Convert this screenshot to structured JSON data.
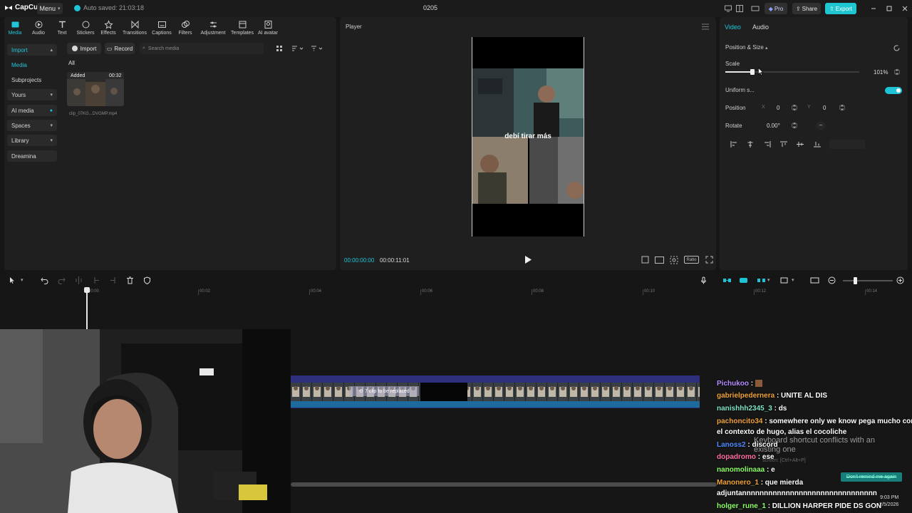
{
  "app": {
    "logo_text": "CapCut",
    "menu_label": "Menu",
    "autosave": "Auto saved: 21:03:18",
    "project_title": "0205"
  },
  "topbar": {
    "pro_label": "Pro",
    "share_label": "Share",
    "export_label": "Export"
  },
  "toolbar": [
    {
      "label": "Media",
      "icon": "media-icon"
    },
    {
      "label": "Audio",
      "icon": "audio-icon"
    },
    {
      "label": "Text",
      "icon": "text-icon"
    },
    {
      "label": "Stickers",
      "icon": "sticker-icon"
    },
    {
      "label": "Effects",
      "icon": "effects-icon"
    },
    {
      "label": "Transitions",
      "icon": "transitions-icon"
    },
    {
      "label": "Captions",
      "icon": "captions-icon"
    },
    {
      "label": "Filters",
      "icon": "filters-icon"
    },
    {
      "label": "Adjustment",
      "icon": "adjustment-icon"
    },
    {
      "label": "Templates",
      "icon": "templates-icon"
    },
    {
      "label": "AI avatar",
      "icon": "ai-avatar-icon"
    }
  ],
  "sidebar": [
    {
      "label": "Import"
    },
    {
      "label": "Media"
    },
    {
      "label": "Subprojects"
    },
    {
      "label": "Yours"
    },
    {
      "label": "AI media"
    },
    {
      "label": "Spaces"
    },
    {
      "label": "Library"
    },
    {
      "label": "Dreamina"
    }
  ],
  "media": {
    "import_label": "Import",
    "record_label": "Record",
    "search_placeholder": "Search media",
    "filter_all": "All",
    "clip": {
      "badge": "Added",
      "duration": "00:32",
      "filename": "clip_07KG...DVGMP.mp4"
    }
  },
  "player": {
    "title": "Player",
    "caption": "debí tirar más",
    "time_current": "00:00:00:00",
    "time_total": "00:00:11:01",
    "ratio_label": "Ratio"
  },
  "props": {
    "tab_video": "Video",
    "tab_audio": "Audio",
    "section": "Position & Size",
    "scale_label": "Scale",
    "scale_value": "101%",
    "scale_fraction": 0.2,
    "uniform_label": "Uniform s...",
    "position_label": "Position",
    "pos_x_label": "X",
    "pos_x": "0",
    "pos_y_label": "Y",
    "pos_y": "0",
    "rotate_label": "Rotate",
    "rotate_value": "0.00°",
    "rotate_flip": "–"
  },
  "timeline": {
    "ticks": [
      "00:00",
      "00:02",
      "00:04",
      "00:06",
      "00:08",
      "00:10",
      "00:12",
      "00:14"
    ],
    "replace_label": "7 clip to be replaced"
  },
  "chat": [
    {
      "user": "Pichukoo",
      "color": "#b48cff",
      "text": ":"
    },
    {
      "user": "gabrielpedernera",
      "color": "#f0a23a",
      "text": ": UNITE AL DIS"
    },
    {
      "user": "nanishhh2345_3",
      "color": "#7ee3c8",
      "text": ": ds"
    },
    {
      "user": "pachoncito34",
      "color": "#f0a23a",
      "text": ": somewhere only we know pega mucho con"
    },
    {
      "user": "",
      "color": "#ffffff",
      "text": "el contexto de hugo, alias el cocoliche"
    },
    {
      "user": "Lanoss2",
      "color": "#4f8cff",
      "text": ": discord"
    },
    {
      "user": "dopadromo",
      "color": "#ff6fa5",
      "text": ": ese"
    },
    {
      "user": "nanomolinaaa",
      "color": "#8cff66",
      "text": ": e"
    },
    {
      "user": "Manonero_1",
      "color": "#f0a23a",
      "text": ": que mierda"
    },
    {
      "user": "",
      "color": "#ffffff",
      "text": "adjuntannnnnnnnnnnnnnnnnnnnnnnnnnnnnnn"
    },
    {
      "user": "holger_rune_1",
      "color": "#8cff66",
      "text": ": DILLION HARPER PIDE DS GON"
    }
  ],
  "notification": {
    "text": "Keyboard shortcut conflicts with an existing one",
    "sub": "screen: [Ctrl+Alt+P]",
    "button": "Don't remind me again"
  },
  "clock": {
    "time": "9:03 PM",
    "date": "2/5/2026"
  },
  "colors": {
    "accent": "#1fc3d6",
    "panel": "#1f1f1f",
    "background": "#161616",
    "strip": "#2e2f7a"
  }
}
